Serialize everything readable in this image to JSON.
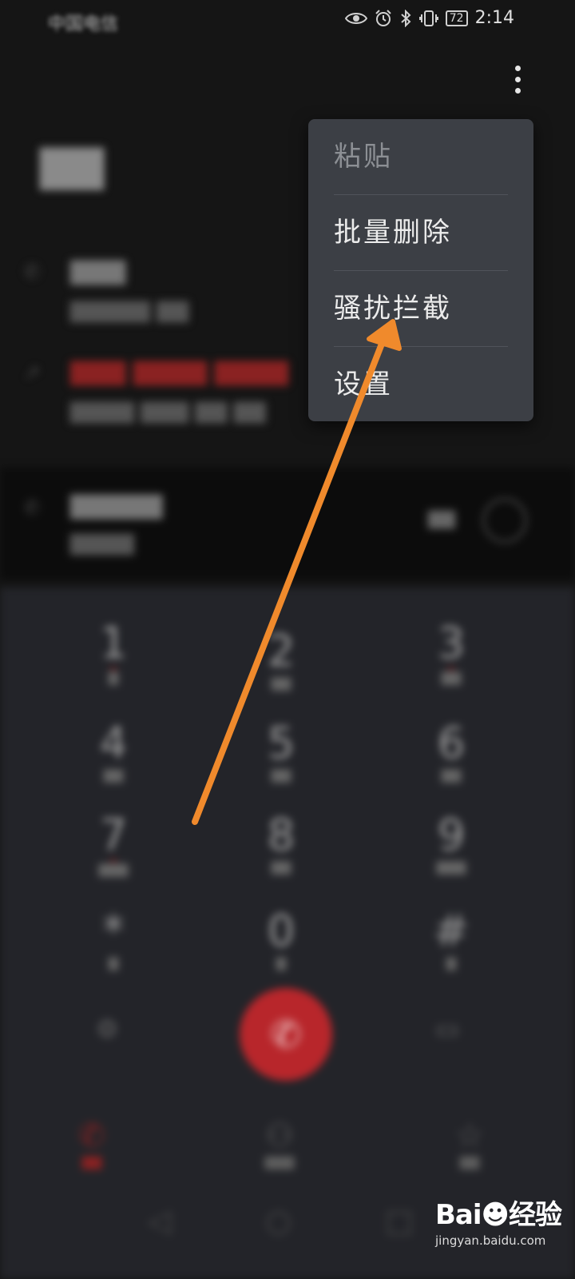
{
  "status_bar": {
    "carrier": "中国电信",
    "battery": "72",
    "time": "2:14",
    "icons": [
      "eye-icon",
      "alarm-icon",
      "bluetooth-icon",
      "vibrate-icon",
      "battery-icon"
    ]
  },
  "menu": {
    "items": [
      {
        "label": "粘贴",
        "enabled": false
      },
      {
        "label": "批量删除",
        "enabled": true
      },
      {
        "label": "骚扰拦截",
        "enabled": true
      },
      {
        "label": "设置",
        "enabled": true
      }
    ]
  },
  "watermark": {
    "brand_left": "Bai",
    "brand_right": "经验",
    "url": "jingyan.baidu.com"
  },
  "colors": {
    "menu_bg": "#3c3f45",
    "arrow": "#f08a2c",
    "call_button": "#b8262b"
  }
}
